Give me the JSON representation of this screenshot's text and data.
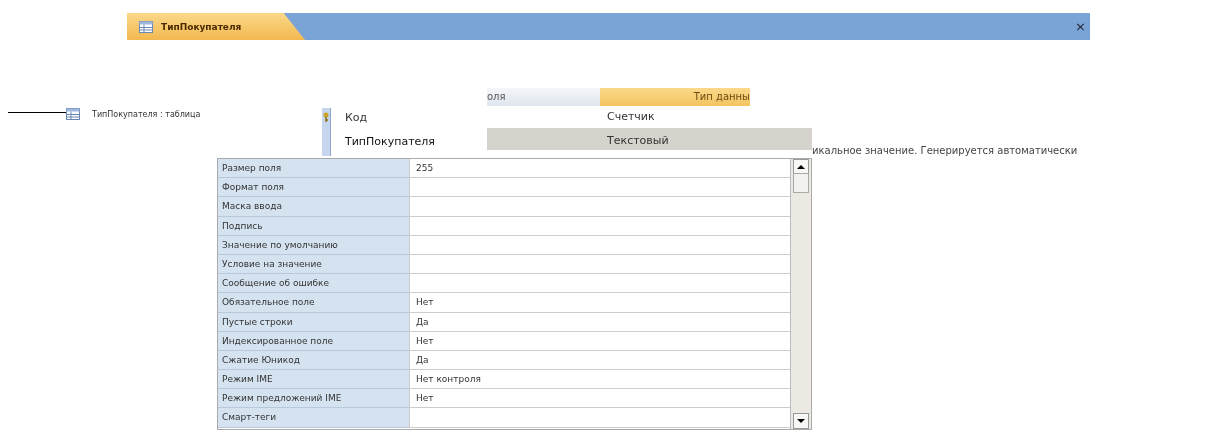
{
  "document_tab": {
    "title": "ТипПокупателя",
    "selected": true,
    "close": "×"
  },
  "object_list": {
    "item": "ТипПокупателя : таблица"
  },
  "field_columns": [
    "оля",
    "Тип данны"
  ],
  "fields": [
    {
      "name": "Код",
      "type": "Счетчик",
      "primary_key": true,
      "selected": false
    },
    {
      "name": "ТипПокупателя",
      "type": "Текстовый",
      "primary_key": false,
      "selected": true
    }
  ],
  "description": "икальное значение. Генерируется автоматически",
  "properties": [
    {
      "label": "Размер поля",
      "value": "255"
    },
    {
      "label": "Формат поля"
    },
    {
      "label": "Маска ввода"
    },
    {
      "label": "Подпись"
    },
    {
      "label": "Значение по умолчанию"
    },
    {
      "label": "Условие на значение"
    },
    {
      "label": "Сообщение об ошибке"
    },
    {
      "label": "Обязательное поле",
      "value": "Нет"
    },
    {
      "label": "Пустые строки",
      "value": "Да"
    },
    {
      "label": "Индексированное поле",
      "value": "Нет"
    },
    {
      "label": "Сжатие Юникод",
      "value": "Да"
    },
    {
      "label": "Режим IME",
      "value": "Нет контроля"
    },
    {
      "label": "Режим предложений IME",
      "value": "Нет"
    },
    {
      "label": "Смарт-теги"
    }
  ]
}
